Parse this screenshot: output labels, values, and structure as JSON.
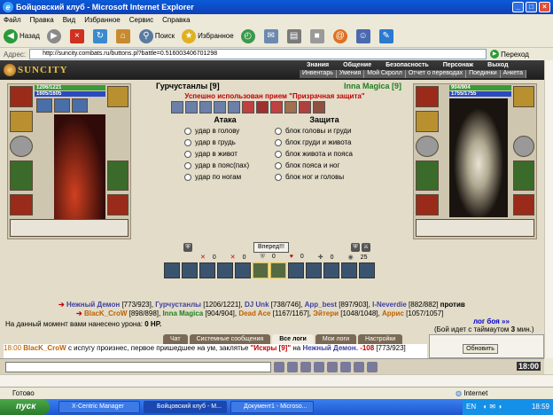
{
  "window": {
    "title": "Бойцовский клуб - Microsoft Internet Explorer"
  },
  "menu": [
    "Файл",
    "Правка",
    "Вид",
    "Избранное",
    "Сервис",
    "Справка"
  ],
  "toolbar": {
    "back": "Назад",
    "search": "Поиск",
    "favorites": "Избранное"
  },
  "address": {
    "label": "Адрес:",
    "url": "http://suncity.combats.ru/buttons.pl?battle=0.516003406701298",
    "go": "Переход"
  },
  "site": {
    "logo": "SUNCITY",
    "nav_top": [
      "Знания",
      "Общение",
      "Безопасность",
      "Персонаж",
      "Выход"
    ],
    "nav_bottom": [
      "Инвентарь",
      "Умения",
      "Мой Скролл",
      "Отчет о переводах",
      "Поединки",
      "Анкета"
    ]
  },
  "left_player": {
    "hp": "1206/1221",
    "mana": "1605/1605"
  },
  "right_player": {
    "hp": "904/904",
    "mana": "1755/1755"
  },
  "battle": {
    "player1": "Гурчустанлы [9]",
    "player2": "Inna Magica [9]",
    "success": "Успешно использован прием \"Призрачная защита\"",
    "attack_head": "Атака",
    "defense_head": "Защита",
    "attacks": [
      "удар в голову",
      "удар в грудь",
      "удар в живот",
      "удар в пояс(пах)",
      "удар по ногам"
    ],
    "defenses": [
      "блок головы и груди",
      "блок груди и живота",
      "блок живота и пояса",
      "блок пояса и ног",
      "блок ног и головы"
    ],
    "forward": "Вперед!!!",
    "stats": [
      "0",
      "0",
      "0",
      "0",
      "0",
      "25"
    ]
  },
  "teams": {
    "line1": [
      {
        "name": "Нежный Демон",
        "stat": "[773/923]",
        "c": "blue"
      },
      {
        "name": "Гурчустанлы",
        "stat": "[1206/1221]",
        "c": "blue"
      },
      {
        "name": "DJ Unk",
        "stat": "[738/746]",
        "c": "blue"
      },
      {
        "name": "App_best",
        "stat": "[897/903]",
        "c": "blue"
      },
      {
        "name": "I-Neverdie",
        "stat": "[882/882]",
        "c": "blue"
      }
    ],
    "versus": "против",
    "line2": [
      {
        "name": "BlacK_CroW",
        "stat": "[898/898]",
        "c": "orange"
      },
      {
        "name": "Inna Magica",
        "stat": "[904/904]",
        "c": "green"
      },
      {
        "name": "Dead Ace",
        "stat": "[1167/1167]",
        "c": "orange"
      },
      {
        "name": "Эйтери",
        "stat": "[1048/1048]",
        "c": "orange"
      },
      {
        "name": "Аррис",
        "stat": "[1057/1057]",
        "c": "orange"
      }
    ],
    "damage_text": "На данный момент вами нанесено урона: ",
    "damage_value": "0 HP.",
    "log_link": "лог боя »»",
    "timeout_pre": "(Бой идет с таймаутом ",
    "timeout_val": "3",
    "timeout_post": " мин.)"
  },
  "chat": {
    "tabs": [
      "Чат",
      "Системные сообщения",
      "Все логи",
      "Мои логи",
      "Настройки"
    ],
    "active_tab": "Все логи",
    "time": "18:00",
    "who": "BlacK_CroW",
    "msg1": " с испугу произнес, первое пришедшее на ум, заклятье ",
    "spell": "\"Искры [9]\"",
    "msg2": " на ",
    "target": "Нежный Демон.",
    "dmg": "-108",
    "dmg_stat": " [773/923]",
    "refresh": "Обновить",
    "clock": "18:00"
  },
  "statusbar": {
    "ready": "Готово",
    "zone": "Internet"
  },
  "taskbar": {
    "start": "пуск",
    "tasks": [
      "X-Centric Manager",
      "Бойцовский клуб - M...",
      "Документ1 - Microso..."
    ],
    "lang": "EN",
    "time": "18:59"
  }
}
